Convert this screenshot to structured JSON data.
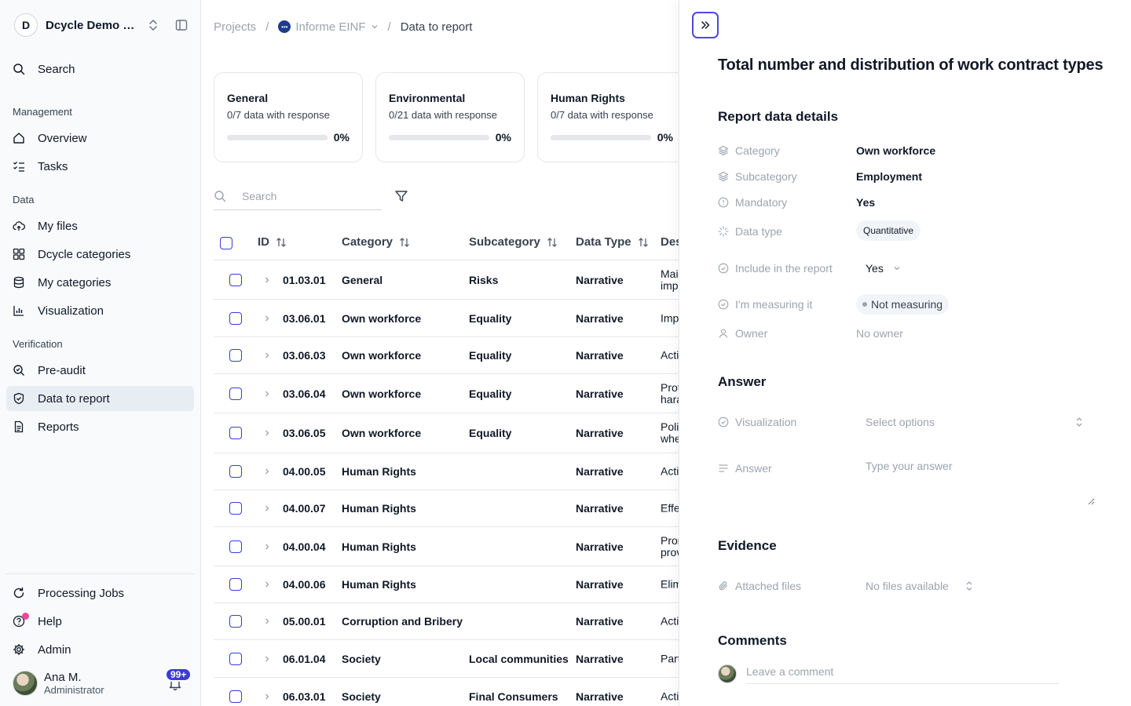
{
  "workspace": {
    "initial": "D",
    "name": "Dcycle Demo T..."
  },
  "sidebar": {
    "search_label": "Search",
    "sections": {
      "management": "Management",
      "data": "Data",
      "verification": "Verification"
    },
    "items": {
      "overview": "Overview",
      "tasks": "Tasks",
      "my_files": "My files",
      "dcycle_categories": "Dcycle categories",
      "my_categories": "My categories",
      "visualization": "Visualization",
      "pre_audit": "Pre-audit",
      "data_to_report": "Data to report",
      "reports": "Reports",
      "processing_jobs": "Processing Jobs",
      "help": "Help",
      "admin": "Admin"
    },
    "user": {
      "name": "Ana M.",
      "role": "Administrator",
      "notifications": "99+"
    }
  },
  "breadcrumb": {
    "projects": "Projects",
    "project": "Informe EINF",
    "current": "Data to report"
  },
  "cards": [
    {
      "title": "General",
      "subtitle": "0/7 data with response",
      "progress": 0,
      "percent": "0%"
    },
    {
      "title": "Environmental",
      "subtitle": "0/21 data with response",
      "progress": 0,
      "percent": "0%"
    },
    {
      "title": "Human Rights",
      "subtitle": "0/7 data with response",
      "progress": 0,
      "percent": "0%"
    }
  ],
  "search": {
    "placeholder": "Search"
  },
  "table": {
    "headers": {
      "id": "ID",
      "category": "Category",
      "subcategory": "Subcategory",
      "data_type": "Data Type",
      "description": "Des"
    },
    "rows": [
      {
        "id": "01.03.01",
        "category": "General",
        "subcategory": "Risks",
        "type": "Narrative",
        "desc": "Mai impa"
      },
      {
        "id": "03.06.01",
        "category": "Own workforce",
        "subcategory": "Equality",
        "type": "Narrative",
        "desc": "Imp"
      },
      {
        "id": "03.06.03",
        "category": "Own workforce",
        "subcategory": "Equality",
        "type": "Narrative",
        "desc": "Acti"
      },
      {
        "id": "03.06.04",
        "category": "Own workforce",
        "subcategory": "Equality",
        "type": "Narrative",
        "desc": "Prot hara"
      },
      {
        "id": "03.06.05",
        "category": "Own workforce",
        "subcategory": "Equality",
        "type": "Narrative",
        "desc": "Poli whe"
      },
      {
        "id": "04.00.05",
        "category": "Human Rights",
        "subcategory": "",
        "type": "Narrative",
        "desc": "Acti"
      },
      {
        "id": "04.00.07",
        "category": "Human Rights",
        "subcategory": "",
        "type": "Narrative",
        "desc": "Effe"
      },
      {
        "id": "04.00.04",
        "category": "Human Rights",
        "subcategory": "",
        "type": "Narrative",
        "desc": "Pron prov"
      },
      {
        "id": "04.00.06",
        "category": "Human Rights",
        "subcategory": "",
        "type": "Narrative",
        "desc": "Elim"
      },
      {
        "id": "05.00.01",
        "category": "Corruption and Bribery",
        "subcategory": "",
        "type": "Narrative",
        "desc": "Acti"
      },
      {
        "id": "06.01.04",
        "category": "Society",
        "subcategory": "Local communities",
        "type": "Narrative",
        "desc": "Part"
      },
      {
        "id": "06.03.01",
        "category": "Society",
        "subcategory": "Final Consumers",
        "type": "Narrative",
        "desc": "Acti"
      }
    ]
  },
  "panel": {
    "title": "Total number and distribution of work contract types",
    "details_heading": "Report data details",
    "labels": {
      "category": "Category",
      "subcategory": "Subcategory",
      "mandatory": "Mandatory",
      "data_type": "Data type",
      "include": "Include in the report",
      "measuring": "I'm measuring it",
      "owner": "Owner"
    },
    "values": {
      "category": "Own workforce",
      "subcategory": "Employment",
      "mandatory": "Yes",
      "data_type": "Quantitative",
      "include": "Yes",
      "measuring": "Not measuring",
      "owner": "No owner"
    },
    "answer_heading": "Answer",
    "visualization_label": "Visualization",
    "visualization_placeholder": "Select options",
    "answer_label": "Answer",
    "answer_placeholder": "Type your answer",
    "evidence_heading": "Evidence",
    "attached_label": "Attached files",
    "attached_value": "No files available",
    "comments_heading": "Comments",
    "comment_placeholder": "Leave a comment"
  },
  "colors": {
    "accent": "#3b3bd6",
    "progress": "#3b82f6",
    "active_bg": "#e8edf3",
    "help_dot": "#ec4899"
  }
}
